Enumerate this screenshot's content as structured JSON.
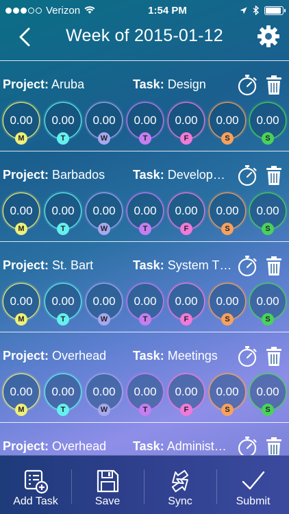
{
  "status": {
    "carrier": "Verizon",
    "time": "1:54 PM",
    "signal_dots_filled": 3,
    "signal_dots_total": 5,
    "battery_level": 0.9
  },
  "nav": {
    "title": "Week of  2015-01-12",
    "back_icon": "chevron-left-icon",
    "settings_icon": "gear-icon"
  },
  "labels": {
    "project": "Project:",
    "task": "Task:"
  },
  "day_colors": {
    "M": "#eef07a",
    "T": "#64f0ee",
    "W": "#a7a8ee",
    "T2": "#c47ef0",
    "F": "#f07ad8",
    "S": "#f6a15f",
    "S2": "#4ad15d"
  },
  "rows": [
    {
      "project": "Aruba",
      "task": "Design",
      "days": [
        {
          "letter": "M",
          "value": "0.00"
        },
        {
          "letter": "T",
          "value": "0.00"
        },
        {
          "letter": "W",
          "value": "0.00"
        },
        {
          "letter": "T",
          "value": "0.00"
        },
        {
          "letter": "F",
          "value": "0.00"
        },
        {
          "letter": "S",
          "value": "0.00"
        },
        {
          "letter": "S",
          "value": "0.00"
        }
      ]
    },
    {
      "project": "Barbados",
      "task": "Develop…",
      "days": [
        {
          "letter": "M",
          "value": "0.00"
        },
        {
          "letter": "T",
          "value": "0.00"
        },
        {
          "letter": "W",
          "value": "0.00"
        },
        {
          "letter": "T",
          "value": "0.00"
        },
        {
          "letter": "F",
          "value": "0.00"
        },
        {
          "letter": "S",
          "value": "0.00"
        },
        {
          "letter": "S",
          "value": "0.00"
        }
      ]
    },
    {
      "project": "St. Bart",
      "task": "System T…",
      "days": [
        {
          "letter": "M",
          "value": "0.00"
        },
        {
          "letter": "T",
          "value": "0.00"
        },
        {
          "letter": "W",
          "value": "0.00"
        },
        {
          "letter": "T",
          "value": "0.00"
        },
        {
          "letter": "F",
          "value": "0.00"
        },
        {
          "letter": "S",
          "value": "0.00"
        },
        {
          "letter": "S",
          "value": "0.00"
        }
      ]
    },
    {
      "project": "Overhead",
      "task": "Meetings",
      "days": [
        {
          "letter": "M",
          "value": "0.00"
        },
        {
          "letter": "T",
          "value": "0.00"
        },
        {
          "letter": "W",
          "value": "0.00"
        },
        {
          "letter": "T",
          "value": "0.00"
        },
        {
          "letter": "F",
          "value": "0.00"
        },
        {
          "letter": "S",
          "value": "0.00"
        },
        {
          "letter": "S",
          "value": "0.00"
        }
      ]
    },
    {
      "project": "Overhead",
      "task": "Administ…",
      "days": []
    }
  ],
  "tabs": [
    {
      "label": "Add Task",
      "icon": "add-task-icon"
    },
    {
      "label": "Save",
      "icon": "floppy-disk-icon"
    },
    {
      "label": "Sync",
      "icon": "sync-arrows-icon"
    },
    {
      "label": "Submit",
      "icon": "checkmark-icon"
    }
  ]
}
